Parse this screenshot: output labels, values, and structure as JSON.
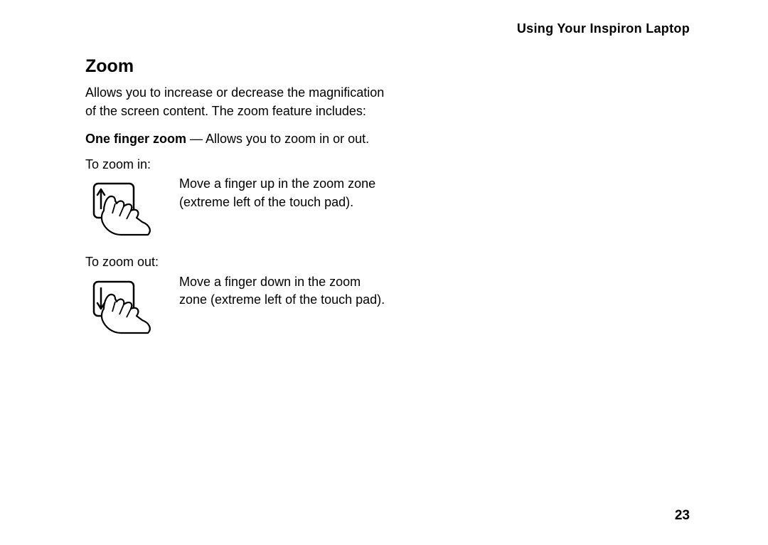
{
  "header": {
    "running_title": "Using Your Inspiron Laptop"
  },
  "section": {
    "heading": "Zoom",
    "intro": "Allows you to increase or decrease the magnification of the screen content. The zoom feature includes:",
    "one_finger": {
      "label": "One finger zoom",
      "desc": " — Allows you to zoom in or out."
    },
    "zoom_in": {
      "label": "To zoom in:",
      "instruction": "Move a finger up in the zoom zone (extreme left of the touch pad)."
    },
    "zoom_out": {
      "label": "To zoom out:",
      "instruction": "Move a finger down in the zoom zone (extreme left of the touch pad)."
    }
  },
  "footer": {
    "page_number": "23"
  }
}
